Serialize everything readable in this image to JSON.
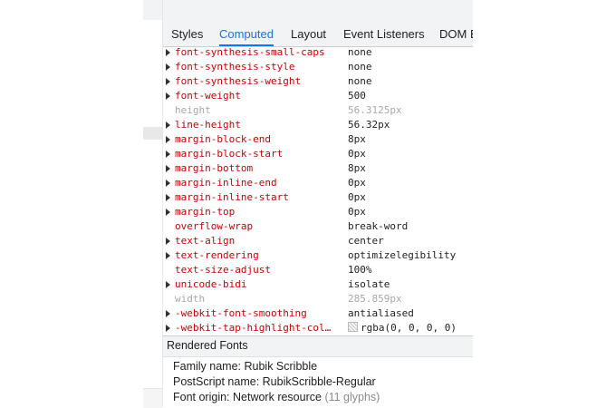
{
  "tabs": [
    {
      "label": "Styles",
      "active": false
    },
    {
      "label": "Computed",
      "active": true
    },
    {
      "label": "Layout",
      "active": false
    },
    {
      "label": "Event Listeners",
      "active": false
    },
    {
      "label": "DOM Breakpoints",
      "active": false
    }
  ],
  "properties": [
    {
      "name": "font-synthesis-small-caps",
      "value": "none",
      "expandable": true,
      "inactive": false
    },
    {
      "name": "font-synthesis-style",
      "value": "none",
      "expandable": true,
      "inactive": false
    },
    {
      "name": "font-synthesis-weight",
      "value": "none",
      "expandable": true,
      "inactive": false
    },
    {
      "name": "font-weight",
      "value": "500",
      "expandable": true,
      "inactive": false
    },
    {
      "name": "height",
      "value": "56.3125px",
      "expandable": false,
      "inactive": true
    },
    {
      "name": "line-height",
      "value": "56.32px",
      "expandable": true,
      "inactive": false
    },
    {
      "name": "margin-block-end",
      "value": "8px",
      "expandable": true,
      "inactive": false
    },
    {
      "name": "margin-block-start",
      "value": "0px",
      "expandable": true,
      "inactive": false
    },
    {
      "name": "margin-bottom",
      "value": "8px",
      "expandable": true,
      "inactive": false
    },
    {
      "name": "margin-inline-end",
      "value": "0px",
      "expandable": true,
      "inactive": false
    },
    {
      "name": "margin-inline-start",
      "value": "0px",
      "expandable": true,
      "inactive": false
    },
    {
      "name": "margin-top",
      "value": "0px",
      "expandable": true,
      "inactive": false
    },
    {
      "name": "overflow-wrap",
      "value": "break-word",
      "expandable": false,
      "inactive": false
    },
    {
      "name": "text-align",
      "value": "center",
      "expandable": true,
      "inactive": false
    },
    {
      "name": "text-rendering",
      "value": "optimizelegibility",
      "expandable": true,
      "inactive": false
    },
    {
      "name": "text-size-adjust",
      "value": "100%",
      "expandable": false,
      "inactive": false
    },
    {
      "name": "unicode-bidi",
      "value": "isolate",
      "expandable": true,
      "inactive": false
    },
    {
      "name": "width",
      "value": "285.859px",
      "expandable": false,
      "inactive": true
    },
    {
      "name": "-webkit-font-smoothing",
      "value": "antialiased",
      "expandable": true,
      "inactive": false
    },
    {
      "name": "-webkit-tap-highlight-col…",
      "value": "rgba(0, 0, 0, 0)",
      "expandable": true,
      "inactive": false,
      "swatch": true
    }
  ],
  "rendered_fonts": {
    "title": "Rendered Fonts",
    "family": "Family name: Rubik Scribble",
    "postscript": "PostScript name: RubikScribble-Regular",
    "origin": "Font origin: Network resource",
    "glyphs": "(11 glyphs)"
  },
  "colors": {
    "property_name": "#c80000",
    "active_tab": "#1a73e8",
    "inactive": "#a8a8a8",
    "toolbar_bg": "#f1f3f4"
  }
}
